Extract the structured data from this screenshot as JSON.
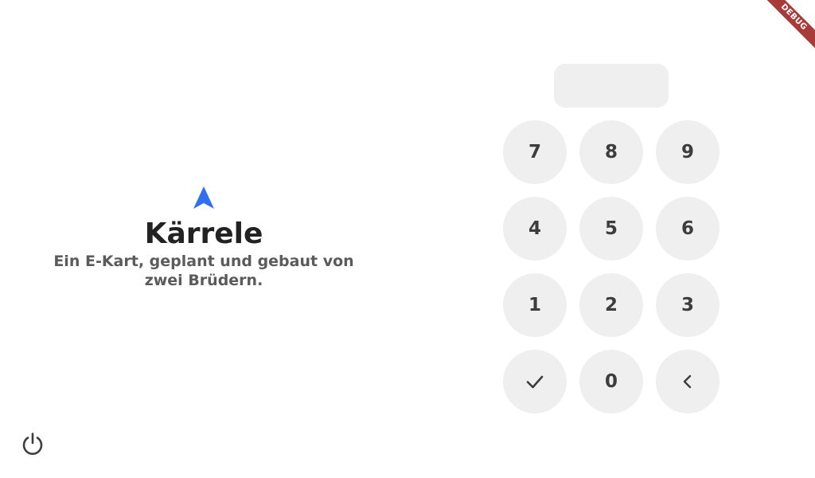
{
  "brand": {
    "icon": "navigation-arrow-icon",
    "title": "Kärrele",
    "subtitle": "Ein E-Kart, geplant und gebaut von zwei Brüdern."
  },
  "pin_display": {
    "value": ""
  },
  "keypad": {
    "keys": [
      "7",
      "8",
      "9",
      "4",
      "5",
      "6",
      "1",
      "2",
      "3",
      "check-icon",
      "0",
      "chevron-left-icon"
    ]
  },
  "power_button": {
    "icon": "power-icon"
  },
  "debug_banner": {
    "label": "DEBUG"
  },
  "colors": {
    "accent": "#2f6ff0",
    "key_background": "#efefef",
    "title": "#222222",
    "subtitle": "#5b5b5b",
    "debug_ribbon": "#a83a3a"
  }
}
